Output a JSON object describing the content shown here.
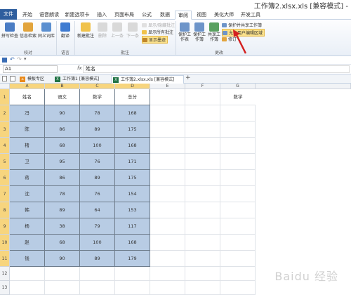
{
  "window": {
    "title": "工作簿2.xlsx.xls [兼容模式] -"
  },
  "tabs": [
    {
      "label": "文件"
    },
    {
      "label": "开始"
    },
    {
      "label": "语音朗读"
    },
    {
      "label": "新建选项卡"
    },
    {
      "label": "插入"
    },
    {
      "label": "页面布局"
    },
    {
      "label": "公式"
    },
    {
      "label": "数据"
    },
    {
      "label": "审阅"
    },
    {
      "label": "视图"
    },
    {
      "label": "美化大师"
    },
    {
      "label": "开发工具"
    }
  ],
  "ribbon": {
    "proofing": {
      "spell": "拼写检查",
      "research": "信息检索",
      "thesaurus": "同义词库",
      "label": "校对"
    },
    "language": {
      "translate": "翻译",
      "label": "语言"
    },
    "comments": {
      "new": "新建批注",
      "delete": "删除",
      "prev": "上一条",
      "next": "下一条",
      "show_hide": "显示/隐藏批注",
      "show_all": "显示所有批注",
      "show_ink": "显示墨迹",
      "label": "批注"
    },
    "changes": {
      "protect_sheet": "保护工作表",
      "protect_workbook": "保护工作簿",
      "share_workbook": "共享工作簿",
      "protect_share": "保护并共享工作簿",
      "allow_edit": "允许用户编辑区域",
      "track": "修订",
      "label": "更改"
    }
  },
  "formula_bar": {
    "name_box": "A1",
    "fx": "fx",
    "content": "姓名"
  },
  "workbook_tabs": [
    {
      "label": "模板专区"
    },
    {
      "label": "工作簿1 [兼容模式]"
    },
    {
      "label": "工作簿2.xlsx.xls [兼容模式]"
    }
  ],
  "sheet": {
    "columns": [
      "A",
      "B",
      "C",
      "D",
      "E",
      "F",
      "G"
    ],
    "rows": [
      "1",
      "2",
      "3",
      "4",
      "5",
      "6",
      "7",
      "8",
      "9",
      "10",
      "11",
      "12",
      "13"
    ],
    "header": [
      "姓名",
      "语文",
      "数学",
      "总分"
    ],
    "data": [
      [
        "冯",
        "90",
        "78",
        "168"
      ],
      [
        "陈",
        "86",
        "89",
        "175"
      ],
      [
        "楮",
        "68",
        "100",
        "168"
      ],
      [
        "卫",
        "95",
        "76",
        "171"
      ],
      [
        "蒋",
        "86",
        "89",
        "175"
      ],
      [
        "沈",
        "78",
        "76",
        "154"
      ],
      [
        "韩",
        "89",
        "64",
        "153"
      ],
      [
        "杨",
        "38",
        "79",
        "117"
      ],
      [
        "赵",
        "68",
        "100",
        "168"
      ],
      [
        "钱",
        "90",
        "89",
        "179"
      ]
    ],
    "g1": "数学"
  },
  "watermark": "Baidu 经验"
}
